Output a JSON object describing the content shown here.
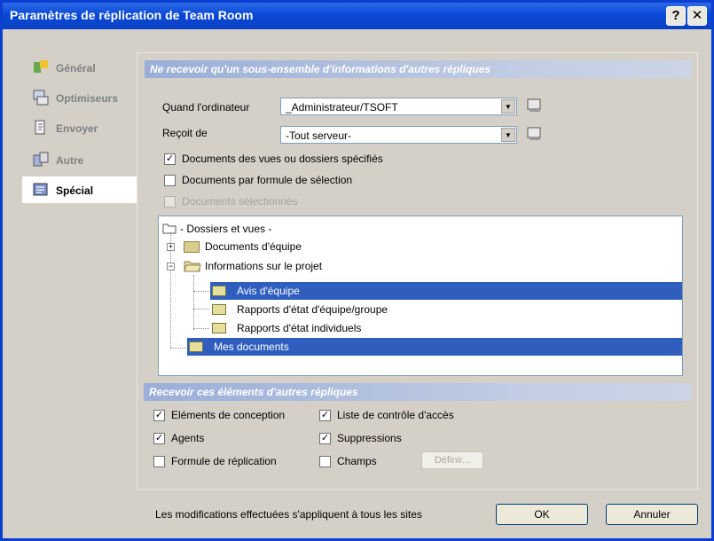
{
  "window": {
    "title": "Paramètres de réplication de Team Room",
    "help_glyph": "?",
    "close_glyph": "✕"
  },
  "sidebar": {
    "items": [
      {
        "label": "Général",
        "icon": "general-icon",
        "active": false
      },
      {
        "label": "Optimiseurs",
        "icon": "optimizers-icon",
        "active": false
      },
      {
        "label": "Envoyer",
        "icon": "send-icon",
        "active": false
      },
      {
        "label": "Autre",
        "icon": "other-icon",
        "active": false
      },
      {
        "label": "Spécial",
        "icon": "special-icon",
        "active": true
      }
    ]
  },
  "subset_section": {
    "header": "Ne recevoir qu'un sous-ensemble d'informations d'autres répliques",
    "when_label": "Quand l'ordinateur",
    "when_value": "_Administrateur/TSOFT",
    "receive_from_label": "Reçoit de",
    "receive_from_value": "-Tout serveur-",
    "checkboxes": [
      {
        "label": "Documents des vues ou dossiers spécifiés",
        "checked": true,
        "enabled": true
      },
      {
        "label": "Documents par formule de sélection",
        "checked": false,
        "enabled": true
      },
      {
        "label": "Documents sélectionnés",
        "checked": false,
        "enabled": false
      }
    ]
  },
  "tree": {
    "nodes": [
      {
        "label": "- Dossiers et vues -",
        "type": "root",
        "selected": false
      },
      {
        "label": "Documents d'équipe",
        "type": "folder",
        "expander": "+",
        "selected": false
      },
      {
        "label": "Informations sur le projet",
        "type": "folder-open",
        "expander": "−",
        "selected": false
      },
      {
        "label": "Avis d'équipe",
        "type": "view",
        "selected": true
      },
      {
        "label": "Rapports d'état d'équipe/groupe",
        "type": "view",
        "selected": false
      },
      {
        "label": "Rapports d'état individuels",
        "type": "view",
        "selected": false
      },
      {
        "label": "Mes documents",
        "type": "view",
        "selected": true
      }
    ]
  },
  "elements_section": {
    "header": "Recevoir ces éléments d'autres répliques",
    "checkboxes": [
      {
        "label": "Eléments de conception",
        "checked": true
      },
      {
        "label": "Liste de contrôle d'accès",
        "checked": true
      },
      {
        "label": "Agents",
        "checked": true
      },
      {
        "label": "Suppressions",
        "checked": true
      },
      {
        "label": "Formule de réplication",
        "checked": false
      },
      {
        "label": "Champs",
        "checked": false
      }
    ],
    "define_button": "Définir..."
  },
  "footer": {
    "note": "Les modifications effectuées s'appliquent à tous les sites",
    "ok_label": "OK",
    "cancel_label": "Annuler"
  },
  "colors": {
    "titlebar": "#0a49d6",
    "selection": "#2f5ebf",
    "section_header": "#9aaed8",
    "dialog_face": "#d4d0c8"
  }
}
